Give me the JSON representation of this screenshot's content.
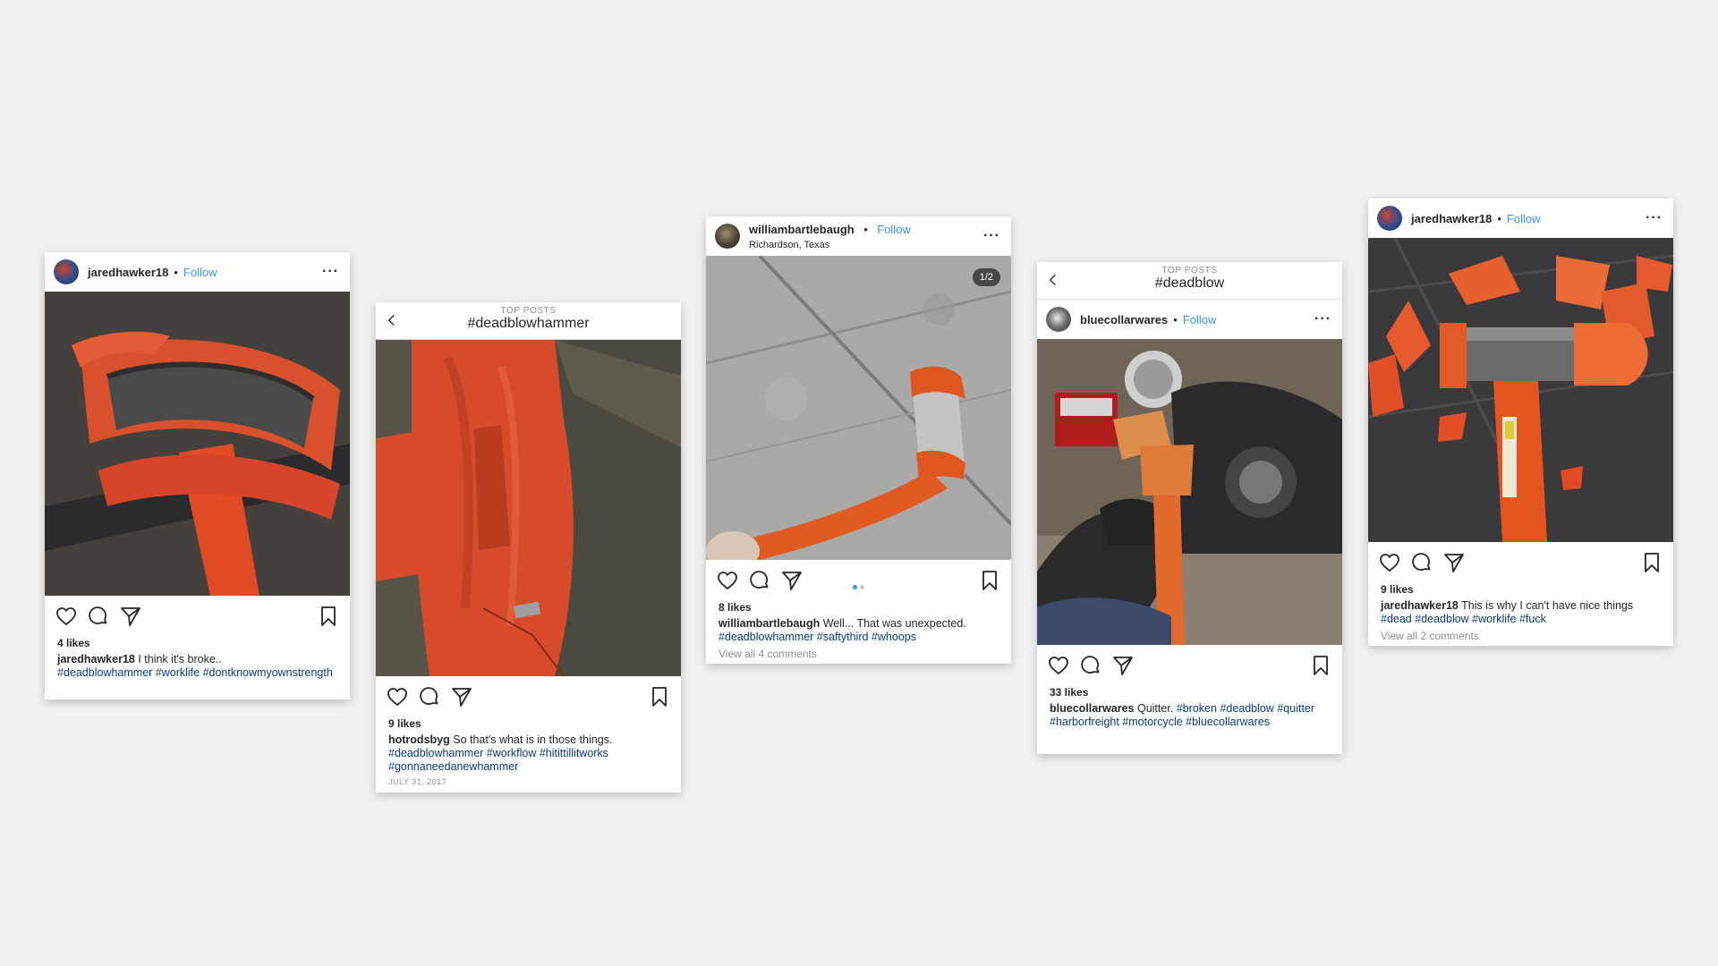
{
  "icons": {
    "like": "heart-icon",
    "comment": "comment-icon",
    "share": "send-icon",
    "save": "bookmark-icon",
    "back": "chevron-left-icon",
    "more": "more-icon"
  },
  "colors": {
    "follow": "#3897f0",
    "hashtag": "#0b3a78",
    "hammer_orange": "#e04a24",
    "background": "#f1f1f1"
  },
  "posts": [
    {
      "username": "jaredhawker18",
      "follow": "Follow",
      "more": "···",
      "likes": "4 likes",
      "caption_user": "jaredhawker18",
      "caption_text": "I think it's broke..",
      "hashtags": "#deadblowhammer #worklife #dontknowmyownstrength"
    },
    {
      "top_posts_label": "TOP POSTS",
      "hashtag_title": "#deadblowhammer",
      "likes": "9 likes",
      "caption_user": "hotrodsbyg",
      "caption_text": "So that's what is in those things.",
      "hashtags": "#deadblowhammer #workflow #hitittillitworks #gonnaneedanewhammer",
      "date": "JULY 31, 2017"
    },
    {
      "username": "williambartlebaugh",
      "follow": "Follow",
      "location": "Richardson, Texas",
      "more": "···",
      "counter": "1/2",
      "likes": "8 likes",
      "caption_user": "williambartlebaugh",
      "caption_text": "Well... That was unexpected.",
      "hashtags": "#deadblowhammer #saftythird #whoops",
      "comments": "View all 4 comments"
    },
    {
      "top_posts_label": "TOP POSTS",
      "hashtag_title": "#deadblow",
      "username": "bluecollarwares",
      "follow": "Follow",
      "more": "···",
      "likes": "33 likes",
      "caption_user": "bluecollarwares",
      "caption_text": "Quitter.",
      "hashtags": "#broken #deadblow #quitter #harborfreight #motorcycle #bluecollarwares"
    },
    {
      "username": "jaredhawker18",
      "follow": "Follow",
      "more": "···",
      "likes": "9 likes",
      "caption_user": "jaredhawker18",
      "caption_text": "This is why I can't have nice things",
      "hashtags": "#dead #deadblow #worklife #fuck",
      "comments": "View all 2 comments"
    }
  ]
}
